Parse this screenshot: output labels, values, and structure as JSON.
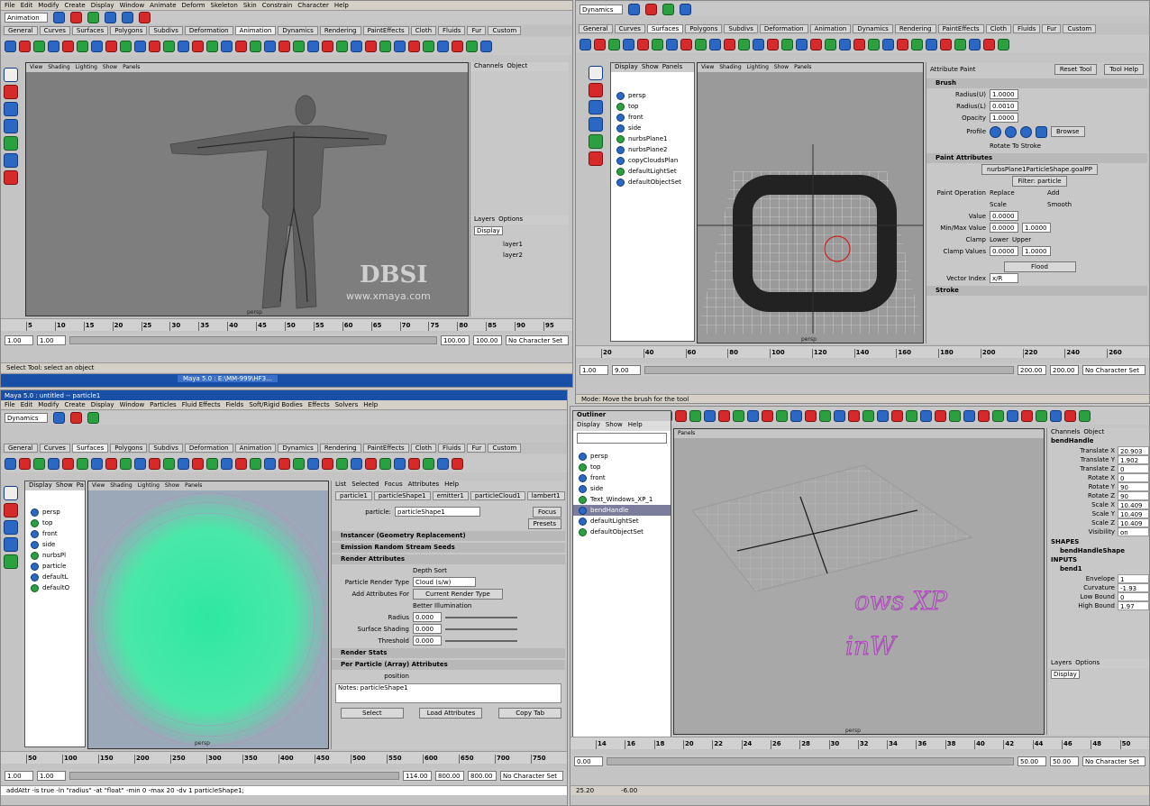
{
  "q1": {
    "mode": "Animation",
    "menus": [
      "File",
      "Edit",
      "Modify",
      "Create",
      "Display",
      "Window",
      "Animate",
      "Deform",
      "Skeleton",
      "Skin",
      "Constrain",
      "Character",
      "Help"
    ],
    "shelf_tabs": [
      "General",
      "Curves",
      "Surfaces",
      "Polygons",
      "Subdivs",
      "Deformation",
      "Animation",
      "Dynamics",
      "Rendering",
      "PaintEffects",
      "Cloth",
      "Fluids",
      "Fur",
      "Custom"
    ],
    "active_tab": "Animation",
    "vp_menus": [
      "View",
      "Shading",
      "Lighting",
      "Show",
      "Panels"
    ],
    "channels_label": "Channels",
    "object_label": "Object",
    "layers_label": "Layers",
    "options_label": "Options",
    "display_label": "Display",
    "layer1": "layer1",
    "layer2": "layer2",
    "ticks": [
      "5",
      "10",
      "15",
      "20",
      "25",
      "30",
      "35",
      "40",
      "45",
      "50",
      "55",
      "60",
      "65",
      "70",
      "75",
      "80",
      "85",
      "90",
      "95"
    ],
    "current": "1.00",
    "start": "1.00",
    "end": "1.00",
    "r1": "100.00",
    "r2": "100.00",
    "charset": "No Character Set",
    "watermark": "DBSI",
    "url": "www.xmaya.com",
    "camera": "persp",
    "status": "Select Tool: select an object",
    "taskbar": "Maya 5.0 : E:\\MM-999\\HF3..."
  },
  "q2": {
    "mode": "Dynamics",
    "shelf_tabs": [
      "General",
      "Curves",
      "Surfaces",
      "Polygons",
      "Subdivs",
      "Deformation",
      "Animation",
      "Dynamics",
      "Rendering",
      "PaintEffects",
      "Cloth",
      "Fluids",
      "Fur",
      "Custom"
    ],
    "active_tab": "Surfaces",
    "outliner_menus": [
      "Display",
      "Show",
      "Panels"
    ],
    "items": [
      "persp",
      "top",
      "front",
      "side",
      "nurbsPlane1",
      "nurbsPlane2",
      "copyCloudsPlan",
      "defaultLightSet",
      "defaultObjectSet"
    ],
    "vp_menus": [
      "View",
      "Shading",
      "Lighting",
      "Show",
      "Panels"
    ],
    "attr_title": "Attribute Paint",
    "reset": "Reset Tool",
    "help": "Tool Help",
    "brush": "Brush",
    "radius_u_lbl": "Radius(U)",
    "radius_u": "1.0000",
    "radius_l_lbl": "Radius(L)",
    "radius_l": "0.0010",
    "opacity_lbl": "Opacity",
    "opacity": "1.0000",
    "profile": "Profile",
    "browse": "Browse",
    "rotate": "Rotate To Stroke",
    "paint_attrs": "Paint Attributes",
    "paint_btn": "nurbsPlane1ParticleShape.goalPP",
    "filter": "Filter: particle",
    "paint_op": "Paint Operation",
    "replace": "Replace",
    "add": "Add",
    "scale": "Scale",
    "smooth": "Smooth",
    "value_lbl": "Value",
    "value": "0.0000",
    "minmax_lbl": "Min/Max Value",
    "min": "0.0000",
    "max": "1.0000",
    "clamp": "Clamp",
    "lower": "Lower",
    "upper": "Upper",
    "clamp_vals": "Clamp Values",
    "cv1": "0.0000",
    "cv2": "1.0000",
    "flood": "Flood",
    "vector": "Vector Index",
    "vector_val": "x/R",
    "stroke": "Stroke",
    "ticks": [
      "20",
      "40",
      "60",
      "80",
      "100",
      "120",
      "140",
      "160",
      "180",
      "200",
      "220",
      "240",
      "260"
    ],
    "current": "1.00",
    "start": "1.00",
    "end": "9.00",
    "r1": "200.00",
    "r2": "200.00",
    "charset": "No Character Set",
    "camera": "persp",
    "status": "Mode: Move the brush for the tool"
  },
  "q3": {
    "title": "Maya 5.0 : untitled -- particle1",
    "menus": [
      "File",
      "Edit",
      "Modify",
      "Create",
      "Display",
      "Window",
      "Particles",
      "Fluid Effects",
      "Fields",
      "Soft/Rigid Bodies",
      "Effects",
      "Solvers",
      "Help"
    ],
    "mode": "Dynamics",
    "shelf_tabs": [
      "General",
      "Curves",
      "Surfaces",
      "Polygons",
      "Subdivs",
      "Deformation",
      "Animation",
      "Dynamics",
      "Rendering",
      "PaintEffects",
      "Cloth",
      "Fluids",
      "Fur",
      "Custom"
    ],
    "active_tab": "Surfaces",
    "outliner_menus": [
      "Display",
      "Show",
      "Pa"
    ],
    "items": [
      "persp",
      "top",
      "front",
      "side",
      "nurbsPl",
      "particle",
      "defaultL",
      "defaultO"
    ],
    "vp_menus": [
      "View",
      "Shading",
      "Lighting",
      "Show",
      "Panels"
    ],
    "ae_menus": [
      "List",
      "Selected",
      "Focus",
      "Attributes",
      "Help"
    ],
    "ae_tabs": [
      "particle1",
      "particleShape1",
      "emitter1",
      "particleCloud1",
      "lambert1"
    ],
    "particle_lbl": "particle:",
    "particle_val": "particleShape1",
    "focus": "Focus",
    "presets": "Presets",
    "s1": "Instancer (Geometry Replacement)",
    "s2": "Emission Random Stream Seeds",
    "s3": "Render Attributes",
    "depth": "Depth Sort",
    "prt_lbl": "Particle Render Type",
    "prt_val": "Cloud (s/w)",
    "add_lbl": "Add Attributes For",
    "current_type": "Current Render Type",
    "better": "Better Illumination",
    "radius_lbl": "Radius",
    "radius": "0.000",
    "surf_lbl": "Surface Shading",
    "surf": "0.000",
    "thresh_lbl": "Threshold",
    "thresh": "0.000",
    "s4": "Render Stats",
    "s5": "Per Particle (Array) Attributes",
    "position": "position",
    "notes": "Notes: particleShape1",
    "select": "Select",
    "load": "Load Attributes",
    "copy": "Copy Tab",
    "ticks": [
      "50",
      "100",
      "150",
      "200",
      "250",
      "300",
      "350",
      "400",
      "450",
      "500",
      "550",
      "600",
      "650",
      "700",
      "750"
    ],
    "current": "114.00",
    "start": "1.00",
    "end": "1.00",
    "r1": "800.00",
    "r2": "800.00",
    "charset": "No Character Set",
    "camera": "persp",
    "status": "addAttr -is true -ln \"radius\" -at \"float\" -min 0 -max 20 -dv 1 particleShape1;"
  },
  "q4": {
    "outliner_title": "Outliner",
    "outliner_menus": [
      "Display",
      "Show",
      "Help"
    ],
    "items": [
      "persp",
      "top",
      "front",
      "side",
      "Text_Windows_XP_1",
      "bendHandle",
      "defaultLightSet",
      "defaultObjectSet"
    ],
    "selected": "bendHandle",
    "panels": "Panels",
    "channels": "Channels",
    "object": "Object",
    "node": "bendHandle",
    "ch": [
      [
        "Translate X",
        "20.903"
      ],
      [
        "Translate Y",
        "1.902"
      ],
      [
        "Translate Z",
        "0"
      ],
      [
        "Rotate X",
        "0"
      ],
      [
        "Rotate Y",
        "90"
      ],
      [
        "Rotate Z",
        "90"
      ],
      [
        "Scale X",
        "10.409"
      ],
      [
        "Scale Y",
        "10.409"
      ],
      [
        "Scale Z",
        "10.409"
      ],
      [
        "Visibility",
        "on"
      ]
    ],
    "shapes": "SHAPES",
    "shape_node": "bendHandleShape",
    "inputs": "INPUTS",
    "input_node": "bend1",
    "inp": [
      [
        "Envelope",
        "1"
      ],
      [
        "Curvature",
        "-1.93"
      ],
      [
        "Low Bound",
        "0"
      ],
      [
        "High Bound",
        "1.97"
      ]
    ],
    "layers": "Layers",
    "options": "Options",
    "display": "Display",
    "text3d": "ows XP",
    "text3d2": "inW",
    "ticks": [
      "14",
      "16",
      "18",
      "20",
      "22",
      "24",
      "26",
      "28",
      "30",
      "32",
      "34",
      "36",
      "38",
      "40",
      "42",
      "44",
      "46",
      "48",
      "50"
    ],
    "current": "0.00",
    "start": "0.00",
    "end": "0.00",
    "r1": "50.00",
    "r2": "50.00",
    "charset": "No Character Set",
    "camera": "persp",
    "coord1": "25.20",
    "coord2": "-6.00"
  }
}
